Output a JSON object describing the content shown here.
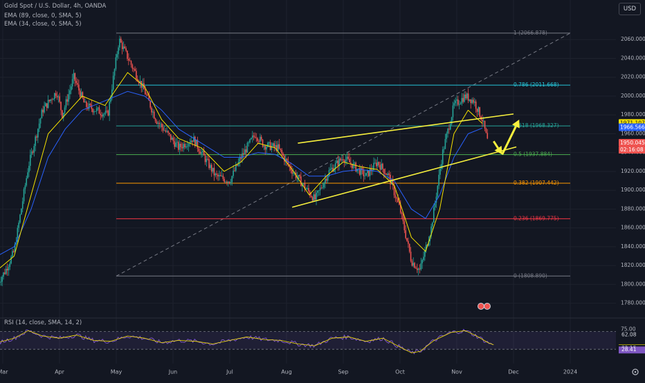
{
  "header": {
    "title": "Gold Spot / U.S. Dollar, 4h, OANDA",
    "ema1": "EMA (89, close, 0, SMA, 5)",
    "ema2": "EMA (34, close, 0, SMA, 5)",
    "currency": "USD",
    "rsi_label": "RSI (14, close, SMA, 14, 2)"
  },
  "colors": {
    "background": "#131722",
    "grid": "#1e222d",
    "candle_up": "#26a69a",
    "candle_down": "#ef5350",
    "ema89": "#2962ff",
    "ema34": "#f5e100",
    "trendline": "#f7f03d",
    "fib_1": "#787b86",
    "fib_786": "#26c6da",
    "fib_618": "#26a69a",
    "fib_5": "#4caf50",
    "fib_382": "#ff9800",
    "fib_236": "#f23645",
    "fib_0": "#787b86",
    "rsi": "#7e57c2"
  },
  "chart_data": {
    "type": "candlestick",
    "ylim": [
      1768,
      2080
    ],
    "y_ticks": [
      1780,
      1800,
      1820,
      1840,
      1860,
      1880,
      1900,
      1920,
      1940,
      1960,
      1980,
      2000,
      2020,
      2040,
      2060
    ],
    "y_tick_labels": [
      "1780.000",
      "1800.000",
      "1820.000",
      "1840.000",
      "1860.000",
      "1880.000",
      "1900.000",
      "1920.000",
      "1940.000",
      "1960.000",
      "1980.000",
      "2000.000",
      "2020.000",
      "2040.000",
      "2060.000"
    ],
    "x_ticks": [
      "Mar",
      "Apr",
      "May",
      "Jun",
      "Jul",
      "Aug",
      "Sep",
      "Oct",
      "Nov",
      "Dec",
      "2024"
    ],
    "x_tick_positions": [
      0,
      1,
      2,
      3,
      4,
      5,
      6,
      7,
      8,
      9,
      10
    ],
    "price_path": [
      [
        -0.1,
        1800
      ],
      [
        0.05,
        1815
      ],
      [
        0.2,
        1835
      ],
      [
        0.45,
        1925
      ],
      [
        0.7,
        1985
      ],
      [
        0.95,
        2005
      ],
      [
        1.05,
        1980
      ],
      [
        1.25,
        2020
      ],
      [
        1.45,
        1990
      ],
      [
        1.65,
        1985
      ],
      [
        1.85,
        1980
      ],
      [
        2.05,
        2060
      ],
      [
        2.25,
        2035
      ],
      [
        2.5,
        2005
      ],
      [
        2.7,
        1975
      ],
      [
        2.9,
        1960
      ],
      [
        3.1,
        1945
      ],
      [
        3.35,
        1955
      ],
      [
        3.55,
        1935
      ],
      [
        3.75,
        1915
      ],
      [
        4.0,
        1910
      ],
      [
        4.2,
        1935
      ],
      [
        4.45,
        1960
      ],
      [
        4.6,
        1948
      ],
      [
        4.85,
        1945
      ],
      [
        5.05,
        1925
      ],
      [
        5.3,
        1905
      ],
      [
        5.5,
        1890
      ],
      [
        5.75,
        1920
      ],
      [
        6.0,
        1935
      ],
      [
        6.2,
        1925
      ],
      [
        6.4,
        1915
      ],
      [
        6.6,
        1930
      ],
      [
        6.8,
        1915
      ],
      [
        7.0,
        1880
      ],
      [
        7.2,
        1825
      ],
      [
        7.35,
        1815
      ],
      [
        7.55,
        1860
      ],
      [
        7.75,
        1940
      ],
      [
        7.95,
        1990
      ],
      [
        8.15,
        2000
      ],
      [
        8.3,
        1995
      ],
      [
        8.45,
        1975
      ],
      [
        8.55,
        1950
      ]
    ],
    "ema89_path": [
      [
        -0.1,
        1830
      ],
      [
        0.2,
        1840
      ],
      [
        0.5,
        1880
      ],
      [
        0.8,
        1935
      ],
      [
        1.1,
        1965
      ],
      [
        1.4,
        1985
      ],
      [
        1.8,
        1995
      ],
      [
        2.2,
        2005
      ],
      [
        2.5,
        2000
      ],
      [
        2.8,
        1985
      ],
      [
        3.1,
        1965
      ],
      [
        3.5,
        1950
      ],
      [
        3.9,
        1935
      ],
      [
        4.2,
        1935
      ],
      [
        4.5,
        1940
      ],
      [
        4.8,
        1938
      ],
      [
        5.1,
        1928
      ],
      [
        5.4,
        1915
      ],
      [
        5.7,
        1915
      ],
      [
        6.0,
        1920
      ],
      [
        6.3,
        1922
      ],
      [
        6.6,
        1920
      ],
      [
        6.9,
        1910
      ],
      [
        7.2,
        1880
      ],
      [
        7.45,
        1870
      ],
      [
        7.7,
        1895
      ],
      [
        7.95,
        1935
      ],
      [
        8.2,
        1960
      ],
      [
        8.45,
        1966
      ]
    ],
    "ema34_path": [
      [
        -0.1,
        1815
      ],
      [
        0.2,
        1830
      ],
      [
        0.5,
        1895
      ],
      [
        0.8,
        1960
      ],
      [
        1.1,
        1980
      ],
      [
        1.4,
        2000
      ],
      [
        1.8,
        1990
      ],
      [
        2.2,
        2025
      ],
      [
        2.5,
        2010
      ],
      [
        2.8,
        1975
      ],
      [
        3.1,
        1955
      ],
      [
        3.5,
        1945
      ],
      [
        3.9,
        1920
      ],
      [
        4.2,
        1930
      ],
      [
        4.5,
        1950
      ],
      [
        4.8,
        1945
      ],
      [
        5.1,
        1922
      ],
      [
        5.4,
        1895
      ],
      [
        5.7,
        1915
      ],
      [
        6.0,
        1930
      ],
      [
        6.3,
        1925
      ],
      [
        6.6,
        1922
      ],
      [
        6.9,
        1905
      ],
      [
        7.2,
        1850
      ],
      [
        7.45,
        1835
      ],
      [
        7.7,
        1880
      ],
      [
        7.95,
        1960
      ],
      [
        8.2,
        1985
      ],
      [
        8.45,
        1971
      ]
    ],
    "fibonacci": [
      {
        "level": "1",
        "price": 2066.878,
        "label": "1 (2066.878)"
      },
      {
        "level": "0.786",
        "price": 2011.668,
        "label": "0.786 (2011.668)"
      },
      {
        "level": "0.618",
        "price": 1968.327,
        "label": "0.618 (1968.327)"
      },
      {
        "level": "0.5",
        "price": 1937.884,
        "label": "0.5 (1937.884)"
      },
      {
        "level": "0.382",
        "price": 1907.442,
        "label": "0.382 (1907.442)"
      },
      {
        "level": "0.236",
        "price": 1869.775,
        "label": "0.236 (1869.775)"
      },
      {
        "level": "0",
        "price": 1808.89,
        "label": "0 (1808.890)"
      }
    ],
    "fib_x_range": [
      2.0,
      10.0
    ],
    "fib_diagonal": [
      [
        2.0,
        1808.89
      ],
      [
        10.0,
        2066.878
      ]
    ],
    "trendlines": [
      {
        "from": [
          5.2,
          1950
        ],
        "to": [
          9.0,
          1981
        ]
      },
      {
        "from": [
          5.1,
          1882
        ],
        "to": [
          9.05,
          1946
        ]
      }
    ],
    "arrows": [
      {
        "from": [
          8.65,
          1952
        ],
        "to": [
          8.8,
          1938
        ]
      },
      {
        "from": [
          8.8,
          1938
        ],
        "to": [
          9.1,
          1975
        ]
      }
    ],
    "price_labels": [
      {
        "price": 1971.107,
        "text": "1971.107",
        "bg": "#f5e100",
        "fg": "#131722"
      },
      {
        "price": 1966.566,
        "text": "1966.566",
        "bg": "#2962ff",
        "fg": "#ffffff"
      },
      {
        "price": 1950.045,
        "text": "1950.045",
        "bg": "#ef5350",
        "fg": "#ffffff"
      },
      {
        "countdown": "02:16:08"
      }
    ],
    "rsi": {
      "ylim": [
        10,
        85
      ],
      "band": [
        30,
        70
      ],
      "path": [
        [
          -0.1,
          45
        ],
        [
          0.2,
          55
        ],
        [
          0.45,
          72
        ],
        [
          0.7,
          60
        ],
        [
          1.0,
          55
        ],
        [
          1.3,
          62
        ],
        [
          1.6,
          50
        ],
        [
          1.9,
          48
        ],
        [
          2.2,
          60
        ],
        [
          2.5,
          55
        ],
        [
          2.8,
          45
        ],
        [
          3.1,
          50
        ],
        [
          3.4,
          48
        ],
        [
          3.7,
          42
        ],
        [
          4.0,
          50
        ],
        [
          4.3,
          58
        ],
        [
          4.6,
          52
        ],
        [
          4.9,
          50
        ],
        [
          5.2,
          42
        ],
        [
          5.5,
          38
        ],
        [
          5.8,
          55
        ],
        [
          6.1,
          58
        ],
        [
          6.4,
          48
        ],
        [
          6.7,
          55
        ],
        [
          7.0,
          35
        ],
        [
          7.2,
          22
        ],
        [
          7.35,
          25
        ],
        [
          7.6,
          50
        ],
        [
          7.9,
          68
        ],
        [
          8.15,
          72
        ],
        [
          8.35,
          60
        ],
        [
          8.55,
          45
        ],
        [
          8.65,
          40
        ]
      ],
      "labels": [
        {
          "value": 62.08,
          "text": "62.08",
          "bg": "#131722",
          "fg": "#d1d4dc"
        },
        {
          "value": 33.12,
          "text": "33.12",
          "bg": "#f5e100",
          "fg": "#131722"
        },
        {
          "value": 32.15,
          "text": "32.15",
          "bg": "#131722",
          "fg": "#d1d4dc"
        },
        {
          "value": 28.41,
          "text": "28.41",
          "bg": "#7e57c2",
          "fg": "#ffffff"
        }
      ],
      "ticks": [
        "75.00"
      ]
    }
  }
}
